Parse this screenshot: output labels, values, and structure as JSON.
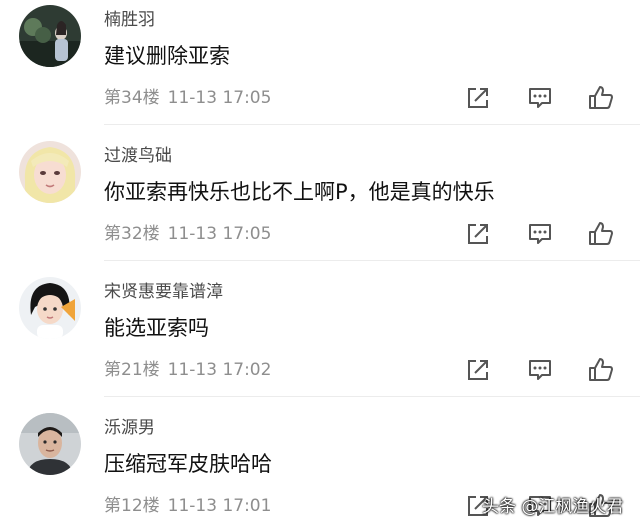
{
  "comments": [
    {
      "username": "楠胜羽",
      "content": "建议删除亚索",
      "floor": "第34楼",
      "time": "11-13 17:05"
    },
    {
      "username": "过渡鸟础",
      "content": "你亚索再快乐也比不上啊P，他是真的快乐",
      "floor": "第32楼",
      "time": "11-13 17:05"
    },
    {
      "username": "宋贤惠要靠谱漳",
      "content": "能选亚索吗",
      "floor": "第21楼",
      "time": "11-13 17:02"
    },
    {
      "username": "泺源男",
      "content": "压缩冠军皮肤哈哈",
      "floor": "第12楼",
      "time": "11-13 17:01"
    }
  ],
  "actions": {
    "share_icon": "share-icon",
    "reply_icon": "reply-icon",
    "like_icon": "thumbs-up-icon"
  },
  "colors": {
    "username": "#4a4a4a",
    "content": "#111111",
    "meta": "#8e8e8e",
    "icon": "#555555"
  },
  "watermark": "头条 @江枫渔火君"
}
